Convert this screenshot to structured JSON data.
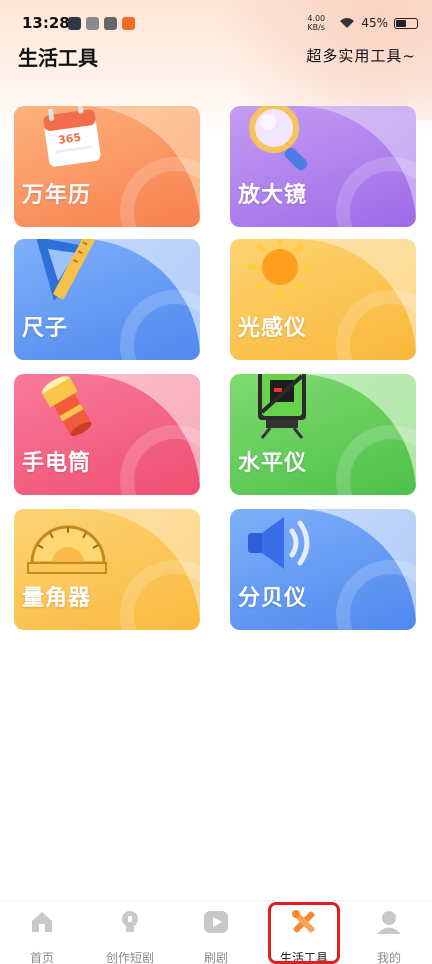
{
  "status_bar": {
    "time": "13:28",
    "network": "4.00 KB/s",
    "battery_percent": "45%"
  },
  "header": {
    "title": "生活工具",
    "subtitle": "超多实用工具~"
  },
  "tools": [
    {
      "label": "万年历",
      "icon": "calendar-icon"
    },
    {
      "label": "放大镜",
      "icon": "magnifier-icon"
    },
    {
      "label": "尺子",
      "icon": "ruler-icon"
    },
    {
      "label": "光感仪",
      "icon": "sun-icon"
    },
    {
      "label": "手电筒",
      "icon": "flashlight-icon"
    },
    {
      "label": "水平仪",
      "icon": "level-laser-icon"
    },
    {
      "label": "量角器",
      "icon": "protractor-icon"
    },
    {
      "label": "分贝仪",
      "icon": "speaker-icon"
    }
  ],
  "calendar_badge": "365",
  "bottom_nav": [
    {
      "label": "首页",
      "icon": "home-icon"
    },
    {
      "label": "创作短剧",
      "icon": "lightbulb-icon"
    },
    {
      "label": "刷剧",
      "icon": "play-icon"
    },
    {
      "label": "生活工具",
      "icon": "tools-icon",
      "active": true
    },
    {
      "label": "我的",
      "icon": "profile-icon"
    }
  ],
  "colors": {
    "orange_card": "#fb8f5a",
    "purple_card": "#b07ef0",
    "blue_card": "#5e98f4",
    "yellow_card": "#fbc84f",
    "pink_card": "#f3587f",
    "green_card": "#6ad15e",
    "highlight": "#e02020"
  }
}
